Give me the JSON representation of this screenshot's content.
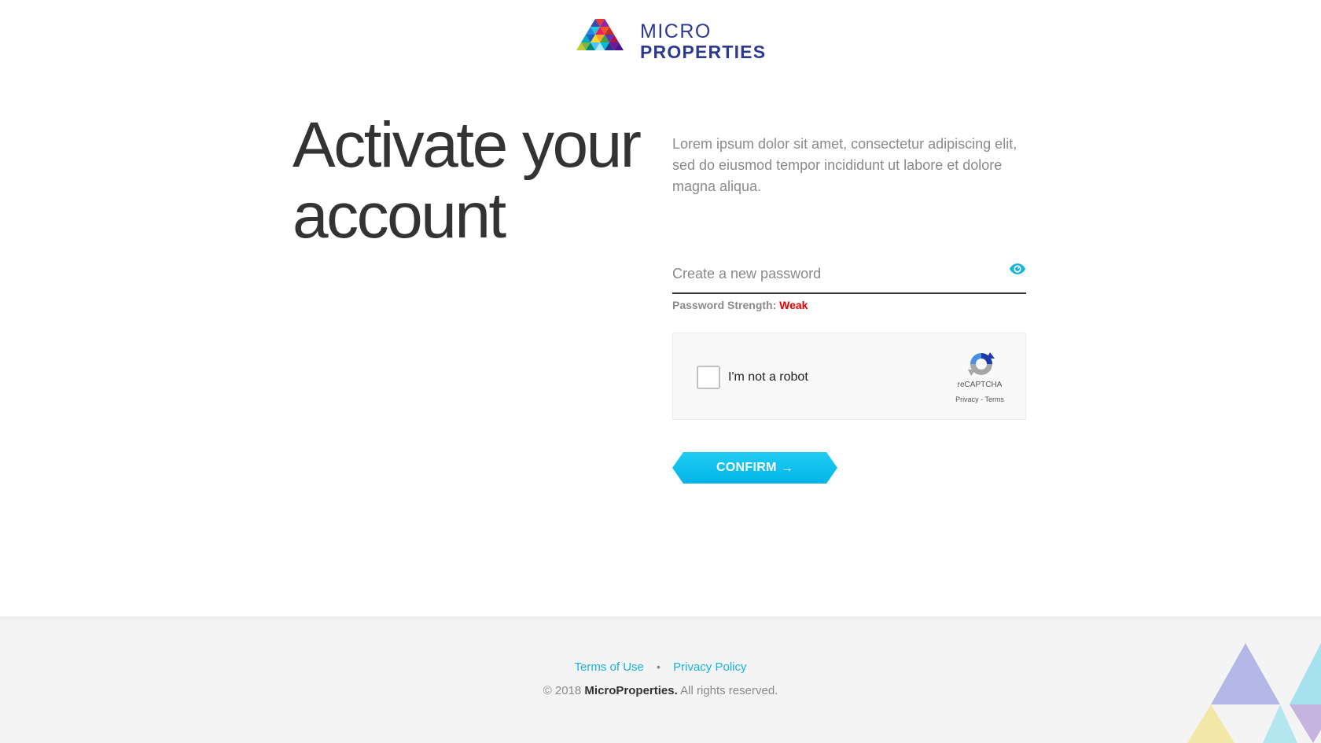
{
  "brand": {
    "logo_line1": "MICRO",
    "logo_line2": "PROPERTIES",
    "logo_icon": "triangle-mosaic-logo"
  },
  "main": {
    "headline": "Activate your account",
    "intro": "Lorem ipsum dolor sit amet, consectetur adipiscing elit, sed do eiusmod tempor incididunt ut labore et dolore magna aliqua."
  },
  "password": {
    "placeholder": "Create a new password",
    "value": "",
    "toggle_icon": "eye-icon",
    "strength_label": "Password Strength:",
    "strength_value": "Weak"
  },
  "recaptcha": {
    "label": "I'm not a robot",
    "brand": "reCAPTCHA",
    "privacy": "Privacy",
    "separator": "-",
    "terms": "Terms",
    "checked": false
  },
  "confirm": {
    "label": "CONFIRM",
    "icon": "arrow-right-icon"
  },
  "footer": {
    "terms_link": "Terms of Use",
    "privacy_link": "Privacy Policy",
    "separator": "•",
    "copyright_prefix": "© 2018",
    "copyright_brand": "MicroProperties.",
    "copyright_suffix": "All rights reserved."
  },
  "colors": {
    "accent": "#00b4e6",
    "logo_text": "#2e3a8f",
    "strength_weak": "#e60000",
    "link": "#17b3e0",
    "footer_bg": "#f4f4f4"
  }
}
